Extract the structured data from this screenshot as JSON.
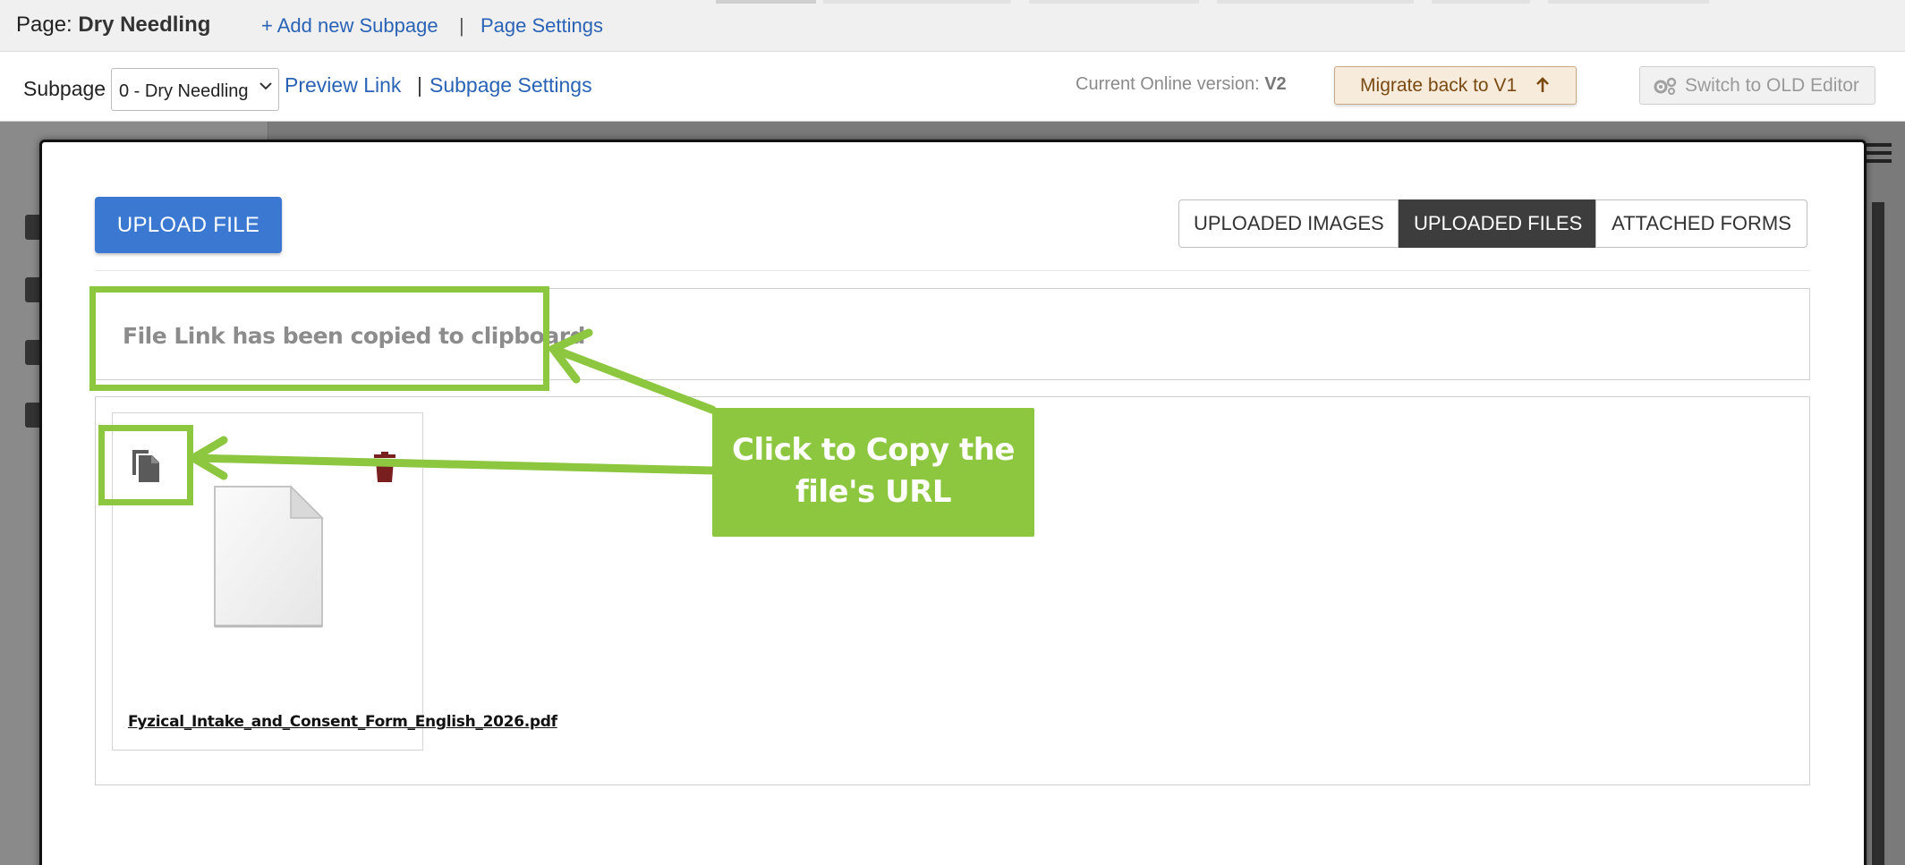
{
  "header": {
    "page_prefix": "Page:",
    "page_name": "Dry Needling",
    "add_subpage": "+ Add new Subpage",
    "separator": "|",
    "page_settings": "Page Settings"
  },
  "subbar": {
    "subpage_label": "Subpage",
    "subpage_selected": "0 - Dry Needling",
    "preview_link": "Preview Link",
    "separator": "|",
    "subpage_settings": "Subpage Settings",
    "online_version_label": "Current Online version:",
    "online_version_value": "V2",
    "migrate_button": "Migrate back to V1",
    "switch_button": "Switch to OLD Editor"
  },
  "modal": {
    "upload_button": "UPLOAD FILE",
    "tabs": [
      {
        "label": "UPLOADED IMAGES",
        "active": false
      },
      {
        "label": "UPLOADED FILES",
        "active": true
      },
      {
        "label": "ATTACHED FORMS",
        "active": false
      }
    ],
    "clipboard_message": "File Link has been copied to clipboard",
    "files": [
      {
        "name": "Fyzical_Intake_and_Consent_Form_English_2026.pdf"
      }
    ]
  },
  "annotation": {
    "callout_line1": "Click to Copy the",
    "callout_line2": "file's URL",
    "color": "#8dc63f"
  },
  "icons": {
    "copy": "copy-icon",
    "trash": "trash-icon",
    "document": "document-icon",
    "gears": "gears-icon",
    "arrow_up": "arrow-up-icon",
    "chevron": "chevron-down-icon",
    "menu": "hamburger-icon"
  },
  "colors": {
    "primary_button": "#3a78d2",
    "active_tab": "#3d3d3d",
    "link": "#2a63b5",
    "trash": "#7a1f1f"
  }
}
